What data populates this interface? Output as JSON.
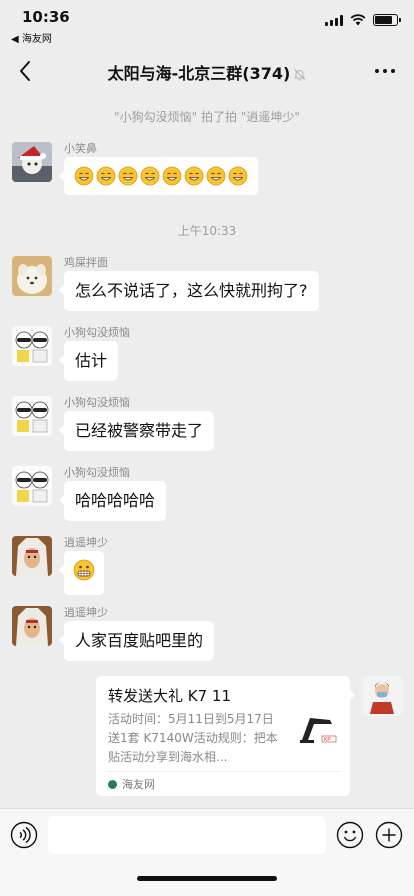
{
  "status_bar": {
    "time": "10:36",
    "back_app": "◀ 海友网",
    "battery_level": 0.8
  },
  "header": {
    "title": "太阳与海-北京三群(374)",
    "back_icon": "chevron-left-icon",
    "mute_icon": "mute-bell-icon",
    "more_icon": "more-dots-icon"
  },
  "messages": {
    "pat_notice": "\"小狗勾没烦恼\" 拍了拍 \"逍遥坤少\"",
    "timestamp": "上午10:33",
    "items": [
      {
        "sender": "小笑鼻",
        "text": "",
        "emoji": "grinning-face-x8",
        "emoji_count": 8
      },
      {
        "sender": "鸡屎拌面",
        "text": "怎么不说话了，这么快就刑拘了?"
      },
      {
        "sender": "小狗勾没烦恼",
        "text": "估计"
      },
      {
        "sender": "小狗勾没烦恼",
        "text": "已经被警察带走了"
      },
      {
        "sender": "小狗勾没烦恼",
        "text": "哈哈哈哈哈"
      },
      {
        "sender": "逍遥坤少",
        "text": "",
        "emoji": "grimacing-face"
      },
      {
        "sender": "逍遥坤少",
        "text": "人家百度贴吧里的"
      }
    ]
  },
  "share_card": {
    "title": "转发送大礼 K7 11",
    "description": "活动时间：5月11日到5月17日送1套 K7140W活动规则：把本贴活动分享到海水相...",
    "source": "海友网",
    "thumbnail": "product-thumbnail"
  },
  "input_bar": {
    "placeholder": "",
    "voice_icon": "voice-icon",
    "emoji_icon": "emoji-icon",
    "plus_icon": "plus-icon"
  },
  "colors": {
    "background": "#ededed",
    "bubble": "#ffffff",
    "system_text": "#9d9d9d"
  }
}
